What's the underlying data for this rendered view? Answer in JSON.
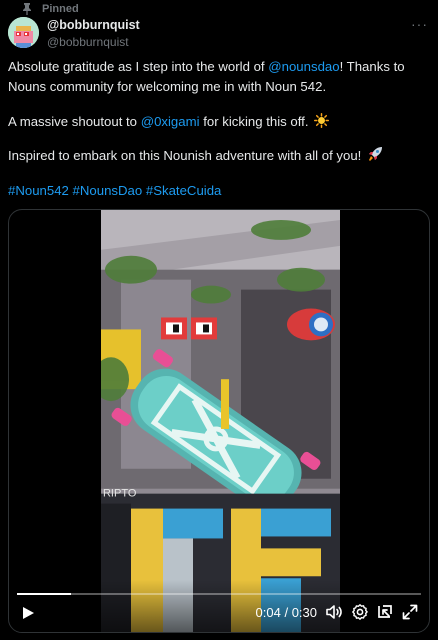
{
  "pinned": {
    "label": "Pinned"
  },
  "author": {
    "display_name": "@bobburnquist",
    "handle": "@bobburnquist"
  },
  "tweet": {
    "p1_a": "Absolute gratitude as I step into the world of ",
    "p1_mention": "@nounsdao",
    "p1_b": "! Thanks to Nouns community for welcoming me in with Noun 542.",
    "p2_a": "A massive shoutout to ",
    "p2_mention": "@0xigami",
    "p2_b": " for kicking this off.",
    "p3": "Inspired to embark on this Nounish adventure with all of you!",
    "hashtags": [
      "#Noun542",
      "#NounsDao",
      "#SkateCuida"
    ]
  },
  "video": {
    "current_time": "0:04",
    "separator": " / ",
    "duration": "0:30",
    "progress": 0.1333,
    "overlay_text": "RIPTO"
  },
  "icons": {
    "pin": "pin-icon",
    "more": "more-icon",
    "sun": "sun-emoji",
    "rocket": "rocket-emoji",
    "play": "play-icon",
    "volume": "volume-icon",
    "settings": "settings-icon",
    "pip": "picture-in-picture-icon",
    "fullscreen": "fullscreen-icon"
  },
  "colors": {
    "background": "#000000",
    "text": "#e7e9ea",
    "secondary": "#71767b",
    "link": "#1d9bf0"
  }
}
